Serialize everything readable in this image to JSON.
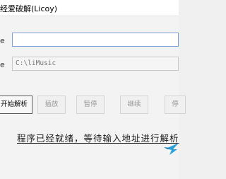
{
  "window": {
    "title": "经爱破解(Licoy)"
  },
  "form": {
    "url_label": "e",
    "url_value": "",
    "url_placeholder": "",
    "path_label": "e",
    "path_value": "C:\\liMusic"
  },
  "buttons": {
    "start": "开始解析",
    "pause_left": "插放",
    "pause": "暂停",
    "continue": "继续",
    "stop": "停"
  },
  "status": {
    "text": "程序已经就绪，等待输入地址进行解析"
  },
  "icons": {
    "bird": "bird-icon"
  },
  "colors": {
    "accent": "#2a9fd6",
    "input_border": "#7a9fd6"
  }
}
